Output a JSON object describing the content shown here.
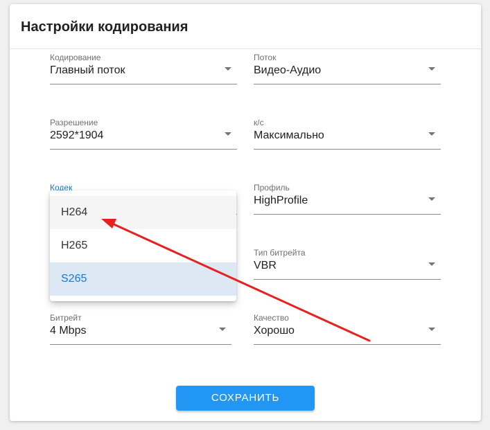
{
  "dialog": {
    "title": "Настройки кодирования"
  },
  "fields": {
    "encoding": {
      "label": "Кодирование",
      "value": "Главный поток"
    },
    "stream": {
      "label": "Поток",
      "value": "Видео-Аудио"
    },
    "resolution": {
      "label": "Разрешение",
      "value": "2592*1904"
    },
    "fps": {
      "label": "к/с",
      "value": "Максимально"
    },
    "codec": {
      "label": "Кодек",
      "value": "S265"
    },
    "profile": {
      "label": "Профиль",
      "value": "HighProfile"
    },
    "bitrate_type": {
      "label": "Тип битрейта",
      "value": "VBR"
    },
    "bitrate": {
      "label": "Битрейт",
      "value": "4 Mbps"
    },
    "quality": {
      "label": "Качество",
      "value": "Хорошо"
    }
  },
  "codec_dropdown": {
    "options": [
      "H264",
      "H265",
      "S265"
    ],
    "selected": "S265",
    "hovered": "H264"
  },
  "actions": {
    "save_label": "СОХРАНИТЬ"
  },
  "colors": {
    "accent": "#2196f3",
    "focus_label": "#1976d2",
    "selected_option_bg": "#dde8f5",
    "annotation_arrow": "#e8201f"
  }
}
